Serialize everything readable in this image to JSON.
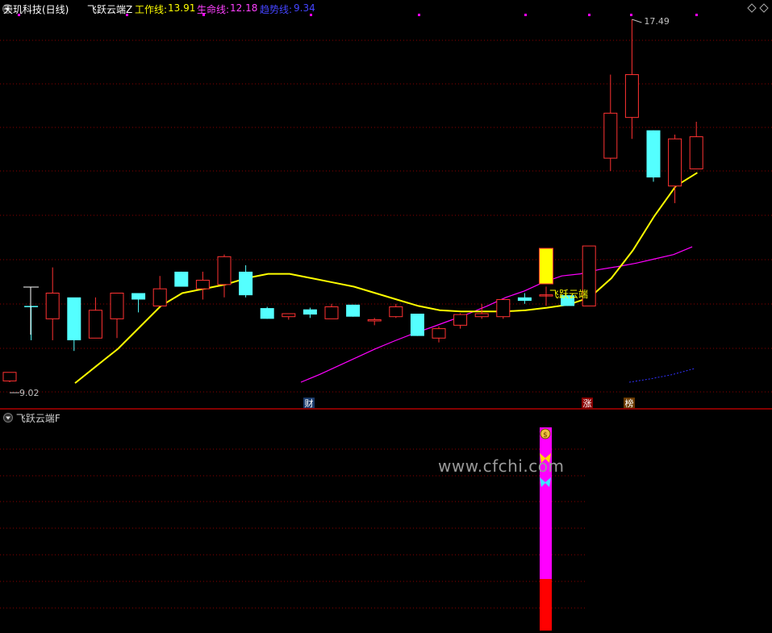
{
  "header": {
    "stock": "天玑科技(日线)",
    "indicator": "飞跃云端Z",
    "work_line_label": "工作线:",
    "work_line_value": "13.91",
    "life_line_label": "生命线:",
    "life_line_value": "12.18",
    "trend_line_label": "趋势线:",
    "trend_line_value": "9.34"
  },
  "sub_panel": {
    "title": "飞跃云端F"
  },
  "watermark": "www.cfchi.com",
  "colors": {
    "up": "#ff3232",
    "down": "#54ffff",
    "work_line": "#ffff00",
    "life_line": "#ff00ff",
    "trend_line": "#3232ff",
    "grid": "#8b0000",
    "signal_candle": "#ffff00"
  },
  "icons": [
    "menu-triangle-icon",
    "diamond-icon",
    "money-bag-icon",
    "yellow-butterfly-icon",
    "cyan-butterfly-icon"
  ],
  "chart_data": {
    "type": "candlestick",
    "price_labels": {
      "high": "17.49",
      "low": "9.02"
    },
    "signal_label": "飞跃云端",
    "event_tags": [
      "财",
      "涨",
      "榜"
    ],
    "candles": [
      {
        "o": 9.05,
        "h": 9.25,
        "l": 9.02,
        "c": 9.25,
        "up": true
      },
      {
        "o": 10.8,
        "h": 10.8,
        "l": 10.0,
        "c": 10.8,
        "up": false
      },
      {
        "o": 10.5,
        "h": 11.7,
        "l": 10.0,
        "c": 11.1,
        "up": true
      },
      {
        "o": 11.0,
        "h": 10.95,
        "l": 9.75,
        "c": 10.0,
        "up": false
      },
      {
        "o": 10.05,
        "h": 11.0,
        "l": 10.05,
        "c": 10.7,
        "up": true
      },
      {
        "o": 10.5,
        "h": 11.0,
        "l": 10.05,
        "c": 11.1,
        "up": true
      },
      {
        "o": 11.1,
        "h": 11.1,
        "l": 10.65,
        "c": 10.95,
        "up": false
      },
      {
        "o": 10.8,
        "h": 11.5,
        "l": 10.8,
        "c": 11.2,
        "up": true
      },
      {
        "o": 11.6,
        "h": 11.6,
        "l": 11.25,
        "c": 11.25,
        "up": false
      },
      {
        "o": 11.2,
        "h": 11.6,
        "l": 10.95,
        "c": 11.4,
        "up": true
      },
      {
        "o": 11.3,
        "h": 12.0,
        "l": 11.0,
        "c": 11.95,
        "up": true
      },
      {
        "o": 11.6,
        "h": 11.75,
        "l": 11.0,
        "c": 11.05,
        "up": false
      },
      {
        "o": 10.75,
        "h": 10.78,
        "l": 10.5,
        "c": 10.5,
        "up": false
      },
      {
        "o": 10.62,
        "h": 10.62,
        "l": 10.48,
        "c": 10.55,
        "up": true
      },
      {
        "o": 10.72,
        "h": 10.76,
        "l": 10.52,
        "c": 10.6,
        "up": false
      },
      {
        "o": 10.5,
        "h": 10.85,
        "l": 10.5,
        "c": 10.78,
        "up": true
      },
      {
        "o": 10.83,
        "h": 10.83,
        "l": 10.55,
        "c": 10.55,
        "up": false
      },
      {
        "o": 10.48,
        "h": 10.52,
        "l": 10.35,
        "c": 10.45,
        "up": true
      },
      {
        "o": 10.55,
        "h": 10.85,
        "l": 10.52,
        "c": 10.78,
        "up": true
      },
      {
        "o": 10.62,
        "h": 10.62,
        "l": 10.1,
        "c": 10.1,
        "up": false
      },
      {
        "o": 10.05,
        "h": 10.32,
        "l": 9.95,
        "c": 10.27,
        "up": true
      },
      {
        "o": 10.35,
        "h": 10.63,
        "l": 10.27,
        "c": 10.6,
        "up": true
      },
      {
        "o": 10.55,
        "h": 10.85,
        "l": 10.5,
        "c": 10.62,
        "up": true
      },
      {
        "o": 10.55,
        "h": 10.95,
        "l": 10.5,
        "c": 10.95,
        "up": true
      },
      {
        "o": 11.0,
        "h": 11.1,
        "l": 10.85,
        "c": 10.92,
        "up": false
      },
      {
        "o": 11.06,
        "h": 11.25,
        "l": 11.06,
        "c": 11.06,
        "up": true
      },
      {
        "o": 11.05,
        "h": 11.05,
        "l": 10.8,
        "c": 10.8,
        "up": false
      },
      {
        "o": 10.8,
        "h": 12.2,
        "l": 10.8,
        "c": 12.2,
        "up": true
      },
      {
        "o": 14.25,
        "h": 16.2,
        "l": 13.95,
        "c": 15.3,
        "up": true
      },
      {
        "o": 15.2,
        "h": 17.49,
        "l": 14.7,
        "c": 16.2,
        "up": true
      },
      {
        "o": 14.9,
        "h": 14.9,
        "l": 13.7,
        "c": 13.8,
        "up": false
      },
      {
        "o": 13.6,
        "h": 14.8,
        "l": 13.2,
        "c": 14.7,
        "up": true
      },
      {
        "o": 14.0,
        "h": 15.1,
        "l": 14.0,
        "c": 14.75,
        "up": true
      }
    ],
    "series": [
      {
        "name": "工作线",
        "values": [
          9.0,
          9.4,
          9.8,
          10.3,
          10.8,
          11.1,
          11.2,
          11.3,
          11.45,
          11.55,
          11.55,
          11.45,
          11.35,
          11.25,
          11.1,
          10.95,
          10.8,
          10.7,
          10.67,
          10.67,
          10.67,
          10.7,
          10.76,
          10.83,
          11.0,
          11.45,
          12.1,
          12.9,
          13.6,
          13.91
        ]
      },
      {
        "name": "生命线",
        "values": [
          9.02,
          9.2,
          9.4,
          9.6,
          9.8,
          9.98,
          10.15,
          10.3,
          10.46,
          10.62,
          10.8,
          11.0,
          11.15,
          11.35,
          11.5,
          11.55,
          11.65,
          11.72,
          11.8,
          11.9,
          12.0,
          12.18
        ]
      },
      {
        "name": "趋势线",
        "values": [
          9.02,
          9.1,
          9.2,
          9.34
        ]
      }
    ],
    "sub_series": [
      {
        "name": "magenta-bar",
        "values": [
          1.0
        ]
      },
      {
        "name": "red-bar",
        "values": [
          0.3
        ]
      }
    ]
  }
}
